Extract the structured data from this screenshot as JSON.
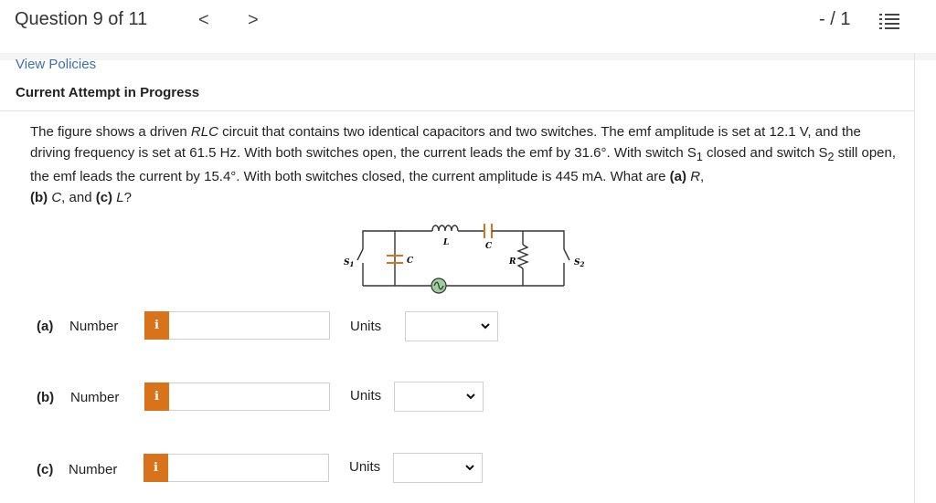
{
  "header": {
    "question_title": "Question 9 of 11",
    "prev_glyph": "<",
    "next_glyph": ">",
    "score": "- / 1"
  },
  "links": {
    "view_policies": "View Policies"
  },
  "status": {
    "attempt": "Current Attempt in Progress"
  },
  "problem": {
    "intro": "The figure shows a driven ",
    "circuit_type": "RLC",
    "p1": " circuit that contains two identical capacitors and two switches. The emf amplitude is set at 12.1 V, and the driving frequency is set at 61.5 Hz. With both switches open, the current leads the emf by 31.6°. With switch S",
    "sub1": "1",
    "p2": " closed and switch S",
    "sub2": "2",
    "p3": " still open, the emf leads the current by 15.4°. With both switches closed, the current amplitude is 445 mA. What are ",
    "part_a": "(a)",
    "var_r": "R",
    "comma1": ", ",
    "part_b": "(b)",
    "var_c": "C",
    "and": ", and ",
    "part_c": "(c)",
    "var_l": "L",
    "qmark": "?"
  },
  "figure": {
    "label_s1": "S",
    "label_s1_sub": "1",
    "label_c_left": "C",
    "label_l": "L",
    "label_c_top": "C",
    "label_r": "R",
    "label_s2": "S",
    "label_s2_sub": "2"
  },
  "answers": [
    {
      "part": "(a)",
      "number_label": "Number",
      "info": "i",
      "value": "",
      "units_label": "Units",
      "unit_value": ""
    },
    {
      "part": "(b)",
      "number_label": "Number",
      "info": "i",
      "value": "",
      "units_label": "Units",
      "unit_value": ""
    },
    {
      "part": "(c)",
      "number_label": "Number",
      "info": "i",
      "value": "",
      "units_label": "Units",
      "unit_value": ""
    }
  ],
  "colors": {
    "accent_orange": "#d9731b",
    "link_blue": "#3a6fb0",
    "source_green": "#9ccf9c"
  }
}
